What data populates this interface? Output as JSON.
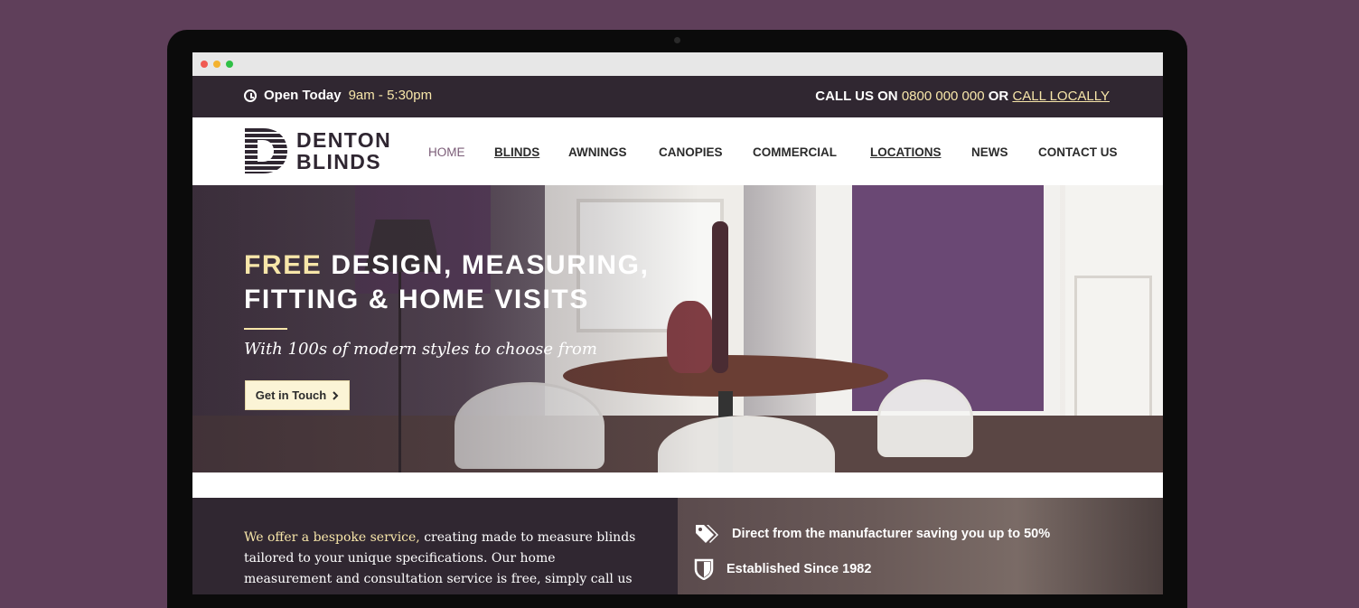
{
  "topbar": {
    "hours_label": "Open Today",
    "hours_value": "9am - 5:30pm",
    "call_prefix": "CALL US ON",
    "phone": "0800 000 000",
    "or_text": "OR",
    "call_locally": "CALL LOCALLY",
    "icon": "clock-icon"
  },
  "logo": {
    "line1": "DENTON",
    "line2": "BLINDS"
  },
  "nav": {
    "items": [
      {
        "label": "HOME"
      },
      {
        "label": "BLINDS"
      },
      {
        "label": "AWNINGS"
      },
      {
        "label": "CANOPIES"
      },
      {
        "label": "COMMERCIAL"
      },
      {
        "label": "LOCATIONS"
      },
      {
        "label": "NEWS"
      },
      {
        "label": "CONTACT US"
      }
    ]
  },
  "hero": {
    "title_accent": "FREE",
    "title_rest": "DESIGN, MEASURING,",
    "title_line2": "FITTING & HOME VISITS",
    "subtitle": "With 100s of modern styles to choose from",
    "button_label": "Get in Touch",
    "button_icon": "chevron-right-icon"
  },
  "about": {
    "accent_text": "We offer a bespoke service,",
    "body_text": " creating made to measure blinds tailored to your unique specifications. Our home measurement and consultation service is free, simply call us"
  },
  "features": {
    "items": [
      {
        "icon": "tags-icon",
        "label": "Direct from the manufacturer saving you up to 50%"
      },
      {
        "icon": "shield-icon",
        "label": "Established Since 1982"
      }
    ]
  },
  "colors": {
    "background": "#5f3f5a",
    "dark": "#302731",
    "accent": "#f7e6a9",
    "nav_active": "#7b5c77"
  }
}
